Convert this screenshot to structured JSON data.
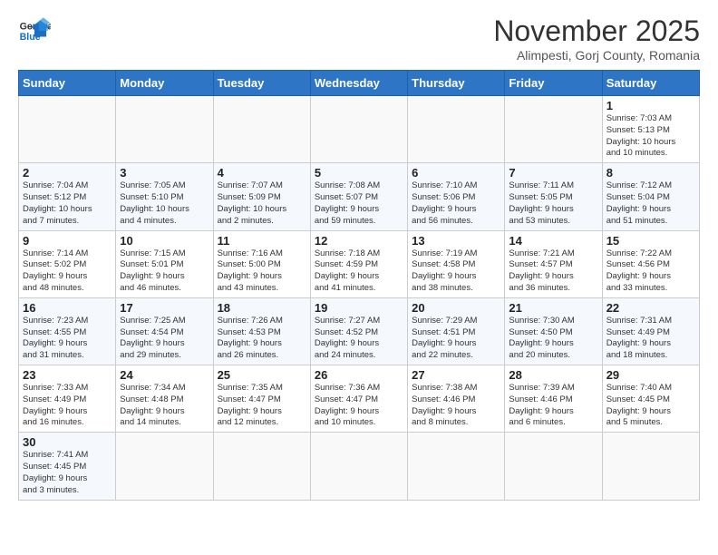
{
  "header": {
    "logo_general": "General",
    "logo_blue": "Blue",
    "month": "November 2025",
    "location": "Alimpesti, Gorj County, Romania"
  },
  "weekdays": [
    "Sunday",
    "Monday",
    "Tuesday",
    "Wednesday",
    "Thursday",
    "Friday",
    "Saturday"
  ],
  "rows": [
    [
      {
        "day": "",
        "info": ""
      },
      {
        "day": "",
        "info": ""
      },
      {
        "day": "",
        "info": ""
      },
      {
        "day": "",
        "info": ""
      },
      {
        "day": "",
        "info": ""
      },
      {
        "day": "",
        "info": ""
      },
      {
        "day": "1",
        "info": "Sunrise: 7:03 AM\nSunset: 5:13 PM\nDaylight: 10 hours\nand 10 minutes."
      }
    ],
    [
      {
        "day": "2",
        "info": "Sunrise: 7:04 AM\nSunset: 5:12 PM\nDaylight: 10 hours\nand 7 minutes."
      },
      {
        "day": "3",
        "info": "Sunrise: 7:05 AM\nSunset: 5:10 PM\nDaylight: 10 hours\nand 4 minutes."
      },
      {
        "day": "4",
        "info": "Sunrise: 7:07 AM\nSunset: 5:09 PM\nDaylight: 10 hours\nand 2 minutes."
      },
      {
        "day": "5",
        "info": "Sunrise: 7:08 AM\nSunset: 5:07 PM\nDaylight: 9 hours\nand 59 minutes."
      },
      {
        "day": "6",
        "info": "Sunrise: 7:10 AM\nSunset: 5:06 PM\nDaylight: 9 hours\nand 56 minutes."
      },
      {
        "day": "7",
        "info": "Sunrise: 7:11 AM\nSunset: 5:05 PM\nDaylight: 9 hours\nand 53 minutes."
      },
      {
        "day": "8",
        "info": "Sunrise: 7:12 AM\nSunset: 5:04 PM\nDaylight: 9 hours\nand 51 minutes."
      }
    ],
    [
      {
        "day": "9",
        "info": "Sunrise: 7:14 AM\nSunset: 5:02 PM\nDaylight: 9 hours\nand 48 minutes."
      },
      {
        "day": "10",
        "info": "Sunrise: 7:15 AM\nSunset: 5:01 PM\nDaylight: 9 hours\nand 46 minutes."
      },
      {
        "day": "11",
        "info": "Sunrise: 7:16 AM\nSunset: 5:00 PM\nDaylight: 9 hours\nand 43 minutes."
      },
      {
        "day": "12",
        "info": "Sunrise: 7:18 AM\nSunset: 4:59 PM\nDaylight: 9 hours\nand 41 minutes."
      },
      {
        "day": "13",
        "info": "Sunrise: 7:19 AM\nSunset: 4:58 PM\nDaylight: 9 hours\nand 38 minutes."
      },
      {
        "day": "14",
        "info": "Sunrise: 7:21 AM\nSunset: 4:57 PM\nDaylight: 9 hours\nand 36 minutes."
      },
      {
        "day": "15",
        "info": "Sunrise: 7:22 AM\nSunset: 4:56 PM\nDaylight: 9 hours\nand 33 minutes."
      }
    ],
    [
      {
        "day": "16",
        "info": "Sunrise: 7:23 AM\nSunset: 4:55 PM\nDaylight: 9 hours\nand 31 minutes."
      },
      {
        "day": "17",
        "info": "Sunrise: 7:25 AM\nSunset: 4:54 PM\nDaylight: 9 hours\nand 29 minutes."
      },
      {
        "day": "18",
        "info": "Sunrise: 7:26 AM\nSunset: 4:53 PM\nDaylight: 9 hours\nand 26 minutes."
      },
      {
        "day": "19",
        "info": "Sunrise: 7:27 AM\nSunset: 4:52 PM\nDaylight: 9 hours\nand 24 minutes."
      },
      {
        "day": "20",
        "info": "Sunrise: 7:29 AM\nSunset: 4:51 PM\nDaylight: 9 hours\nand 22 minutes."
      },
      {
        "day": "21",
        "info": "Sunrise: 7:30 AM\nSunset: 4:50 PM\nDaylight: 9 hours\nand 20 minutes."
      },
      {
        "day": "22",
        "info": "Sunrise: 7:31 AM\nSunset: 4:49 PM\nDaylight: 9 hours\nand 18 minutes."
      }
    ],
    [
      {
        "day": "23",
        "info": "Sunrise: 7:33 AM\nSunset: 4:49 PM\nDaylight: 9 hours\nand 16 minutes."
      },
      {
        "day": "24",
        "info": "Sunrise: 7:34 AM\nSunset: 4:48 PM\nDaylight: 9 hours\nand 14 minutes."
      },
      {
        "day": "25",
        "info": "Sunrise: 7:35 AM\nSunset: 4:47 PM\nDaylight: 9 hours\nand 12 minutes."
      },
      {
        "day": "26",
        "info": "Sunrise: 7:36 AM\nSunset: 4:47 PM\nDaylight: 9 hours\nand 10 minutes."
      },
      {
        "day": "27",
        "info": "Sunrise: 7:38 AM\nSunset: 4:46 PM\nDaylight: 9 hours\nand 8 minutes."
      },
      {
        "day": "28",
        "info": "Sunrise: 7:39 AM\nSunset: 4:46 PM\nDaylight: 9 hours\nand 6 minutes."
      },
      {
        "day": "29",
        "info": "Sunrise: 7:40 AM\nSunset: 4:45 PM\nDaylight: 9 hours\nand 5 minutes."
      }
    ],
    [
      {
        "day": "30",
        "info": "Sunrise: 7:41 AM\nSunset: 4:45 PM\nDaylight: 9 hours\nand 3 minutes."
      },
      {
        "day": "",
        "info": ""
      },
      {
        "day": "",
        "info": ""
      },
      {
        "day": "",
        "info": ""
      },
      {
        "day": "",
        "info": ""
      },
      {
        "day": "",
        "info": ""
      },
      {
        "day": "",
        "info": ""
      }
    ]
  ]
}
